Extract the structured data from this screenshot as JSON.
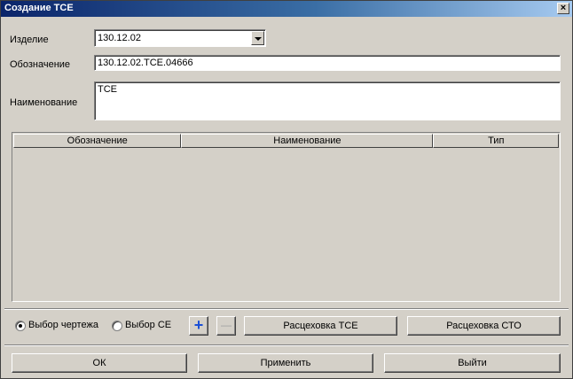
{
  "window": {
    "title": "Создание ТСЕ",
    "close_glyph": "×"
  },
  "form": {
    "product_label": "Изделие",
    "product_value": "130.12.02",
    "designation_label": "Обозначение",
    "designation_value": "130.12.02.ТСЕ.04666",
    "name_label": "Наименование",
    "name_value": "ТСЕ"
  },
  "table": {
    "columns": [
      "Обозначение",
      "Наименование",
      "Тип"
    ],
    "rows": []
  },
  "options": {
    "radio_drawing_label": "Выбор чертежа",
    "radio_drawing_selected": true,
    "radio_ce_label": "Выбор СЕ",
    "radio_ce_selected": false,
    "add_glyph": "+",
    "remove_glyph": "—",
    "route_tce_label": "Расцеховка ТСЕ",
    "route_sto_label": "Расцеховка СТО"
  },
  "footer": {
    "ok_label": "ОК",
    "apply_label": "Применить",
    "exit_label": "Выйти"
  },
  "colors": {
    "plus_icon": "#1a4fd6",
    "titlebar_start": "#0a246a"
  }
}
